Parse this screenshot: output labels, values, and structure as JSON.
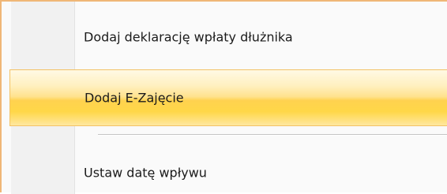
{
  "menu": {
    "items": [
      {
        "label": "Dodaj deklarację wpłaty dłużnika",
        "state": "normal"
      },
      {
        "label": "Dodaj E-Zajęcie",
        "state": "highlighted"
      },
      {
        "label": "Ustaw datę wpływu",
        "state": "normal"
      }
    ]
  },
  "colors": {
    "frame_border": "#f0b777",
    "menu_background": "#fafafa",
    "icon_gutter": "#f1f1f1",
    "highlight_top": "#fff9e4",
    "highlight_bottom": "#ffd24f",
    "separator": "#c5c5c5",
    "text": "#1b1b1b"
  }
}
